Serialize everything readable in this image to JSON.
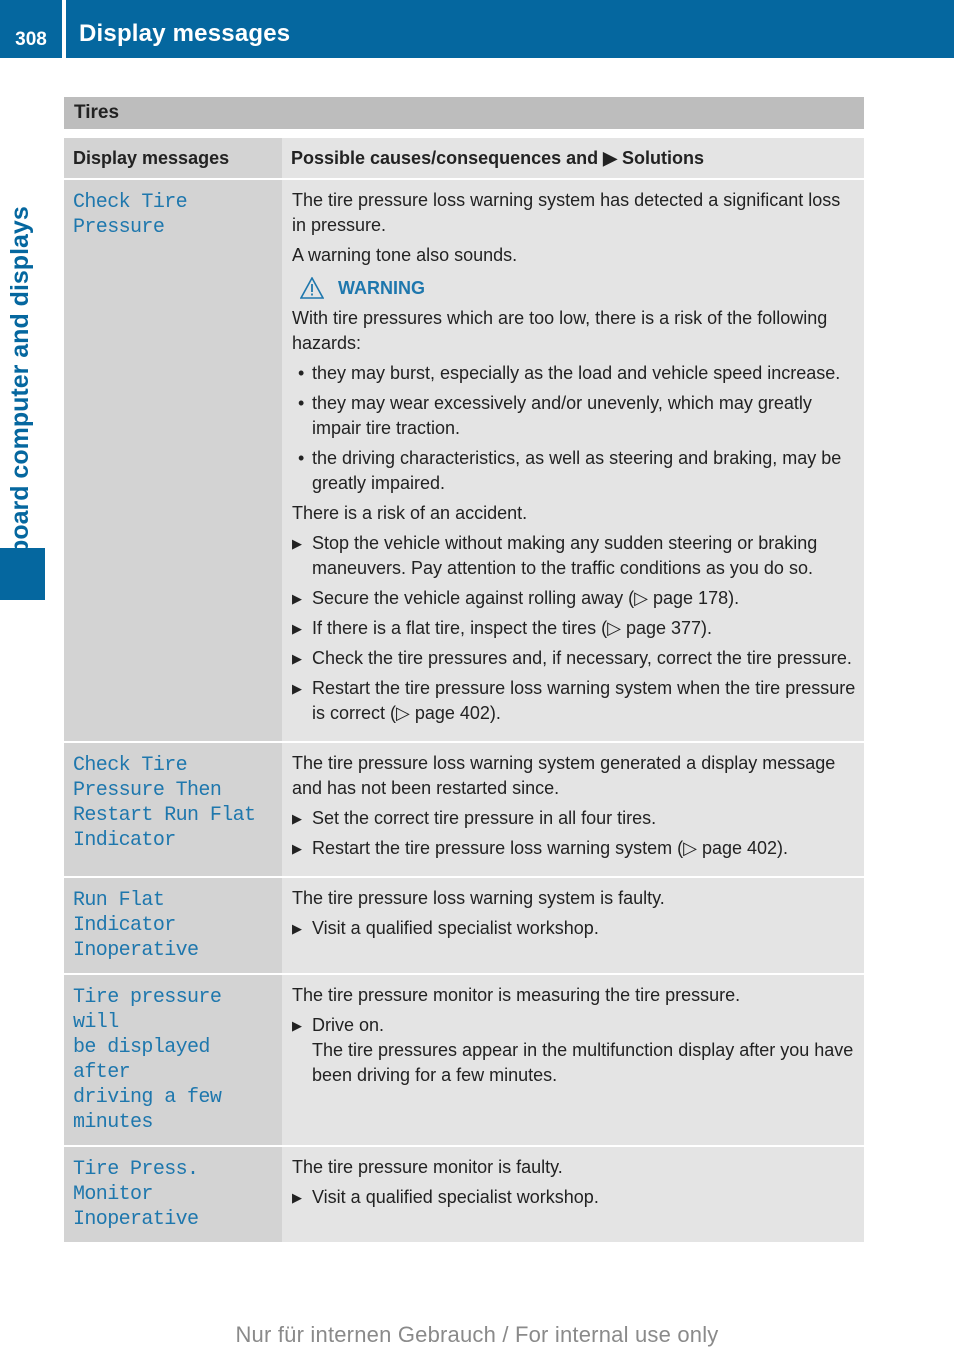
{
  "header": {
    "page_number": "308",
    "section_title": "Display messages",
    "chapter_tab": "On-board computer and displays",
    "accent_color": "#05679f"
  },
  "table": {
    "title": "Tires",
    "columns": [
      "Display messages",
      "Possible causes/consequences and ▶ Solutions"
    ],
    "rows": [
      {
        "message": "Check Tire Pressure",
        "intro": [
          "The tire pressure loss warning system has detected a significant loss in pressure.",
          "A warning tone also sounds."
        ],
        "warning_label": "WARNING",
        "warning_text": "With tire pressures which are too low, there is a risk of the following hazards:",
        "hazards": [
          "they may burst, especially as the load and vehicle speed increase.",
          "they may wear excessively and/or unevenly, which may greatly impair tire traction.",
          "the driving characteristics, as well as steering and braking, may be greatly impaired."
        ],
        "risk": "There is a risk of an accident.",
        "steps": [
          "Stop the vehicle without making any sudden steering or braking maneuvers. Pay attention to the traffic conditions as you do so.",
          "Secure the vehicle against rolling away (▷ page 178).",
          "If there is a flat tire, inspect the tires (▷ page 377).",
          "Check the tire pressures and, if necessary, correct the tire pressure.",
          "Restart the tire pressure loss warning system when the tire pressure is correct (▷ page 402)."
        ]
      },
      {
        "message": "Check Tire\nPressure Then\nRestart Run Flat\nIndicator",
        "intro": [
          "The tire pressure loss warning system generated a display message and has not been restarted since."
        ],
        "steps": [
          "Set the correct tire pressure in all four tires.",
          "Restart the tire pressure loss warning system (▷ page 402)."
        ]
      },
      {
        "message": "Run Flat Indicator\nInoperative",
        "intro": [
          "The tire pressure loss warning system is faulty."
        ],
        "steps": [
          "Visit a qualified specialist workshop."
        ]
      },
      {
        "message": "Tire pressure will\nbe displayed after\ndriving a few\nminutes",
        "intro": [
          "The tire pressure monitor is measuring the tire pressure."
        ],
        "steps": [
          "Drive on."
        ],
        "step_note": "The tire pressures appear in the multifunction display after you have been driving for a few minutes."
      },
      {
        "message": "Tire Press.\nMonitor\nInoperative",
        "intro": [
          "The tire pressure monitor is faulty."
        ],
        "steps": [
          "Visit a qualified specialist workshop."
        ]
      }
    ]
  },
  "icons": {
    "bullet": "•",
    "step_marker": "▶"
  },
  "footer": {
    "watermark": "Nur für internen Gebrauch / For internal use only"
  }
}
